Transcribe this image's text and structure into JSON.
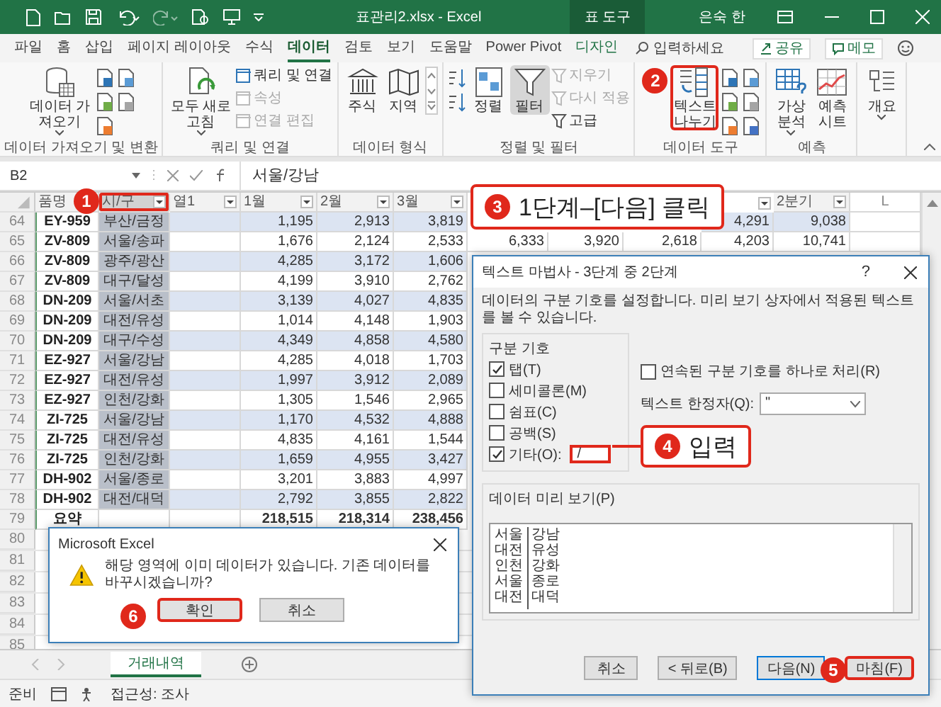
{
  "title_bar": {
    "title": "표관리2.xlsx - Excel",
    "context_tab": "표 도구",
    "user": "은숙 한"
  },
  "ribbon_tabs": [
    {
      "label": "파일",
      "selected": false,
      "kind": "standard"
    },
    {
      "label": "홈",
      "selected": false,
      "kind": "standard"
    },
    {
      "label": "삽입",
      "selected": false,
      "kind": "standard"
    },
    {
      "label": "페이지 레이아웃",
      "selected": false,
      "kind": "standard"
    },
    {
      "label": "수식",
      "selected": false,
      "kind": "standard"
    },
    {
      "label": "데이터",
      "selected": true,
      "kind": "standard"
    },
    {
      "label": "검토",
      "selected": false,
      "kind": "standard"
    },
    {
      "label": "보기",
      "selected": false,
      "kind": "standard"
    },
    {
      "label": "도움말",
      "selected": false,
      "kind": "standard"
    },
    {
      "label": "Power Pivot",
      "selected": false,
      "kind": "standard"
    },
    {
      "label": "디자인",
      "selected": false,
      "kind": "context"
    }
  ],
  "search": {
    "placeholder": "입력하세요"
  },
  "share_button": "공유",
  "comments_button": "메모",
  "ribbon": {
    "groups": [
      {
        "label": "데이터 가져오기 및 변환",
        "items": [
          {
            "kind": "large",
            "label": "데이터 가\n져오기",
            "menu": true
          },
          {
            "kind": "icon"
          },
          {
            "kind": "icon"
          },
          {
            "kind": "icon"
          },
          {
            "kind": "icon"
          },
          {
            "kind": "icon"
          }
        ]
      },
      {
        "label": "쿼리 및 연결",
        "items": [
          {
            "kind": "large",
            "label": "모두 새로\n고침",
            "menu": true
          },
          {
            "kind": "small",
            "label": "쿼리 및 연결",
            "disabled": false
          },
          {
            "kind": "small",
            "label": "속성",
            "disabled": true
          },
          {
            "kind": "small",
            "label": "연결 편집",
            "disabled": true
          }
        ]
      },
      {
        "label": "데이터 형식",
        "items": [
          {
            "kind": "large",
            "label": "주식"
          },
          {
            "kind": "large",
            "label": "지역"
          },
          {
            "kind": "gallery"
          }
        ]
      },
      {
        "label": "정렬 및 필터",
        "items": [
          {
            "kind": "sort"
          },
          {
            "kind": "sort"
          },
          {
            "kind": "large",
            "label": "정렬"
          },
          {
            "kind": "large",
            "label": "필터",
            "active": true
          },
          {
            "kind": "small",
            "label": "지우기",
            "disabled": true
          },
          {
            "kind": "small",
            "label": "다시 적용",
            "disabled": true
          },
          {
            "kind": "small",
            "label": "고급",
            "disabled": false
          }
        ]
      },
      {
        "label": "데이터 도구",
        "items": [
          {
            "kind": "large",
            "label": "텍스트\n나누기",
            "highlighted": true
          },
          {
            "kind": "icon"
          },
          {
            "kind": "icon"
          },
          {
            "kind": "icon"
          },
          {
            "kind": "icon"
          },
          {
            "kind": "icon"
          },
          {
            "kind": "icon"
          }
        ]
      },
      {
        "label": "예측",
        "items": [
          {
            "kind": "large",
            "label": "가상\n분석",
            "menu": true
          },
          {
            "kind": "large",
            "label": "예측\n시트"
          }
        ]
      },
      {
        "items": [
          {
            "kind": "large",
            "label": "개요",
            "menu": true
          }
        ]
      }
    ]
  },
  "formula_bar": {
    "name_box": "B2",
    "formula": "서울/강남"
  },
  "sheet": {
    "columns": [
      {
        "label": "품명",
        "selected": false,
        "highlighted": false
      },
      {
        "label": "시/구",
        "selected": true,
        "highlighted": true
      },
      {
        "label": "열1",
        "selected": false,
        "highlighted": false
      },
      {
        "label": "1월",
        "selected": false,
        "highlighted": false
      },
      {
        "label": "2월",
        "selected": false,
        "highlighted": false
      },
      {
        "label": "3월",
        "selected": false,
        "highlighted": false
      }
    ],
    "right_headers": [
      "2분기",
      "L"
    ],
    "rows": [
      {
        "row": "64",
        "code": "EY-959",
        "city": "부산/금정",
        "values": [
          "1,195",
          "2,913",
          "3,819"
        ],
        "extra": [
          "4,291",
          "9,038"
        ]
      },
      {
        "row": "65",
        "code": "ZV-809",
        "city": "서울/송파",
        "values": [
          "1,676",
          "2,124",
          "2,533"
        ],
        "extra": [
          "6,333",
          "3,920",
          "2,618",
          "4,203",
          "10,741"
        ]
      },
      {
        "row": "66",
        "code": "ZV-809",
        "city": "광주/광산",
        "values": [
          "4,285",
          "3,172",
          "1,606"
        ]
      },
      {
        "row": "67",
        "code": "ZV-809",
        "city": "대구/달성",
        "values": [
          "4,199",
          "3,910",
          "2,762"
        ]
      },
      {
        "row": "68",
        "code": "DN-209",
        "city": "서울/서초",
        "values": [
          "3,139",
          "4,027",
          "4,835"
        ]
      },
      {
        "row": "69",
        "code": "DN-209",
        "city": "대전/유성",
        "values": [
          "1,014",
          "4,148",
          "1,903"
        ]
      },
      {
        "row": "70",
        "code": "DN-209",
        "city": "대구/수성",
        "values": [
          "4,349",
          "4,858",
          "4,580"
        ]
      },
      {
        "row": "71",
        "code": "EZ-927",
        "city": "서울/강남",
        "values": [
          "4,285",
          "4,018",
          "1,703"
        ]
      },
      {
        "row": "72",
        "code": "EZ-927",
        "city": "대전/유성",
        "values": [
          "1,997",
          "3,912",
          "2,089"
        ]
      },
      {
        "row": "73",
        "code": "EZ-927",
        "city": "인천/강화",
        "values": [
          "1,305",
          "1,546",
          "2,965"
        ]
      },
      {
        "row": "74",
        "code": "ZI-725",
        "city": "서울/강남",
        "values": [
          "1,170",
          "4,532",
          "4,888"
        ]
      },
      {
        "row": "75",
        "code": "ZI-725",
        "city": "대전/유성",
        "values": [
          "4,835",
          "4,161",
          "1,544"
        ]
      },
      {
        "row": "76",
        "code": "ZI-725",
        "city": "인천/강화",
        "values": [
          "1,659",
          "4,955",
          "3,427"
        ]
      },
      {
        "row": "77",
        "code": "DH-902",
        "city": "서울/종로",
        "values": [
          "3,201",
          "3,883",
          "4,997"
        ]
      },
      {
        "row": "78",
        "code": "DH-902",
        "city": "대전/대덕",
        "values": [
          "2,792",
          "3,855",
          "2,822"
        ]
      }
    ],
    "total_row": {
      "row": "79",
      "label": "요약",
      "values": [
        "218,515",
        "218,314",
        "238,456"
      ]
    },
    "empty_rows": [
      "80",
      "81",
      "82",
      "83",
      "84",
      "85"
    ]
  },
  "sheet_tabs": [
    {
      "label": "거래내역",
      "selected": true
    }
  ],
  "status_bar": {
    "status": "준비",
    "accessibility": "접근성: 조사"
  },
  "text_wizard": {
    "title": "텍스트 마법사 - 3단계 중 2단계",
    "help": "?",
    "description": "데이터의 구분 기호를 설정합니다. 미리 보기 상자에서 적용된 텍스트를 볼 수 있습니다.",
    "delimiters_label": "구분 기호",
    "delimiters": [
      {
        "label": "탭(T)",
        "checked": true
      },
      {
        "label": "세미콜론(M)",
        "checked": false
      },
      {
        "label": "쉼표(C)",
        "checked": false
      },
      {
        "label": "공백(S)",
        "checked": false
      },
      {
        "label": "기타(O):",
        "checked": true
      }
    ],
    "other_value": "/",
    "other_highlighted": true,
    "consecutive": {
      "label": "연속된 구분 기호를 하나로 처리(R)",
      "checked": false
    },
    "qualifier": {
      "label": "텍스트 한정자(Q):",
      "value": "\""
    },
    "preview_label": "데이터 미리 보기(P)",
    "preview_rows": [
      [
        "서울",
        "강남"
      ],
      [
        "대전",
        "유성"
      ],
      [
        "인천",
        "강화"
      ],
      [
        "서울",
        "종로"
      ],
      [
        "대전",
        "대덕"
      ]
    ],
    "buttons": [
      {
        "label": "취소",
        "kind": "normal",
        "highlighted": false
      },
      {
        "label": "< 뒤로(B)",
        "kind": "normal",
        "highlighted": false
      },
      {
        "label": "다음(N)",
        "kind": "default",
        "highlighted": false
      },
      {
        "label": "마침(F)",
        "kind": "normal",
        "highlighted": true
      }
    ]
  },
  "message_box": {
    "title": "Microsoft Excel",
    "message": "해당 영역에 이미 데이터가 있습니다. 기존 데이터를 바꾸시겠습니까?",
    "buttons": [
      {
        "label": "확인",
        "highlighted": true
      },
      {
        "label": "취소",
        "highlighted": false
      }
    ]
  },
  "callouts": [
    {
      "number": "1",
      "kind": "marker"
    },
    {
      "number": "2",
      "kind": "marker"
    },
    {
      "number": "3",
      "kind": "note",
      "text": "1단계–[다음] 클릭"
    },
    {
      "number": "4",
      "kind": "note",
      "text": "입력"
    },
    {
      "number": "5",
      "kind": "marker"
    },
    {
      "number": "6",
      "kind": "marker"
    }
  ]
}
